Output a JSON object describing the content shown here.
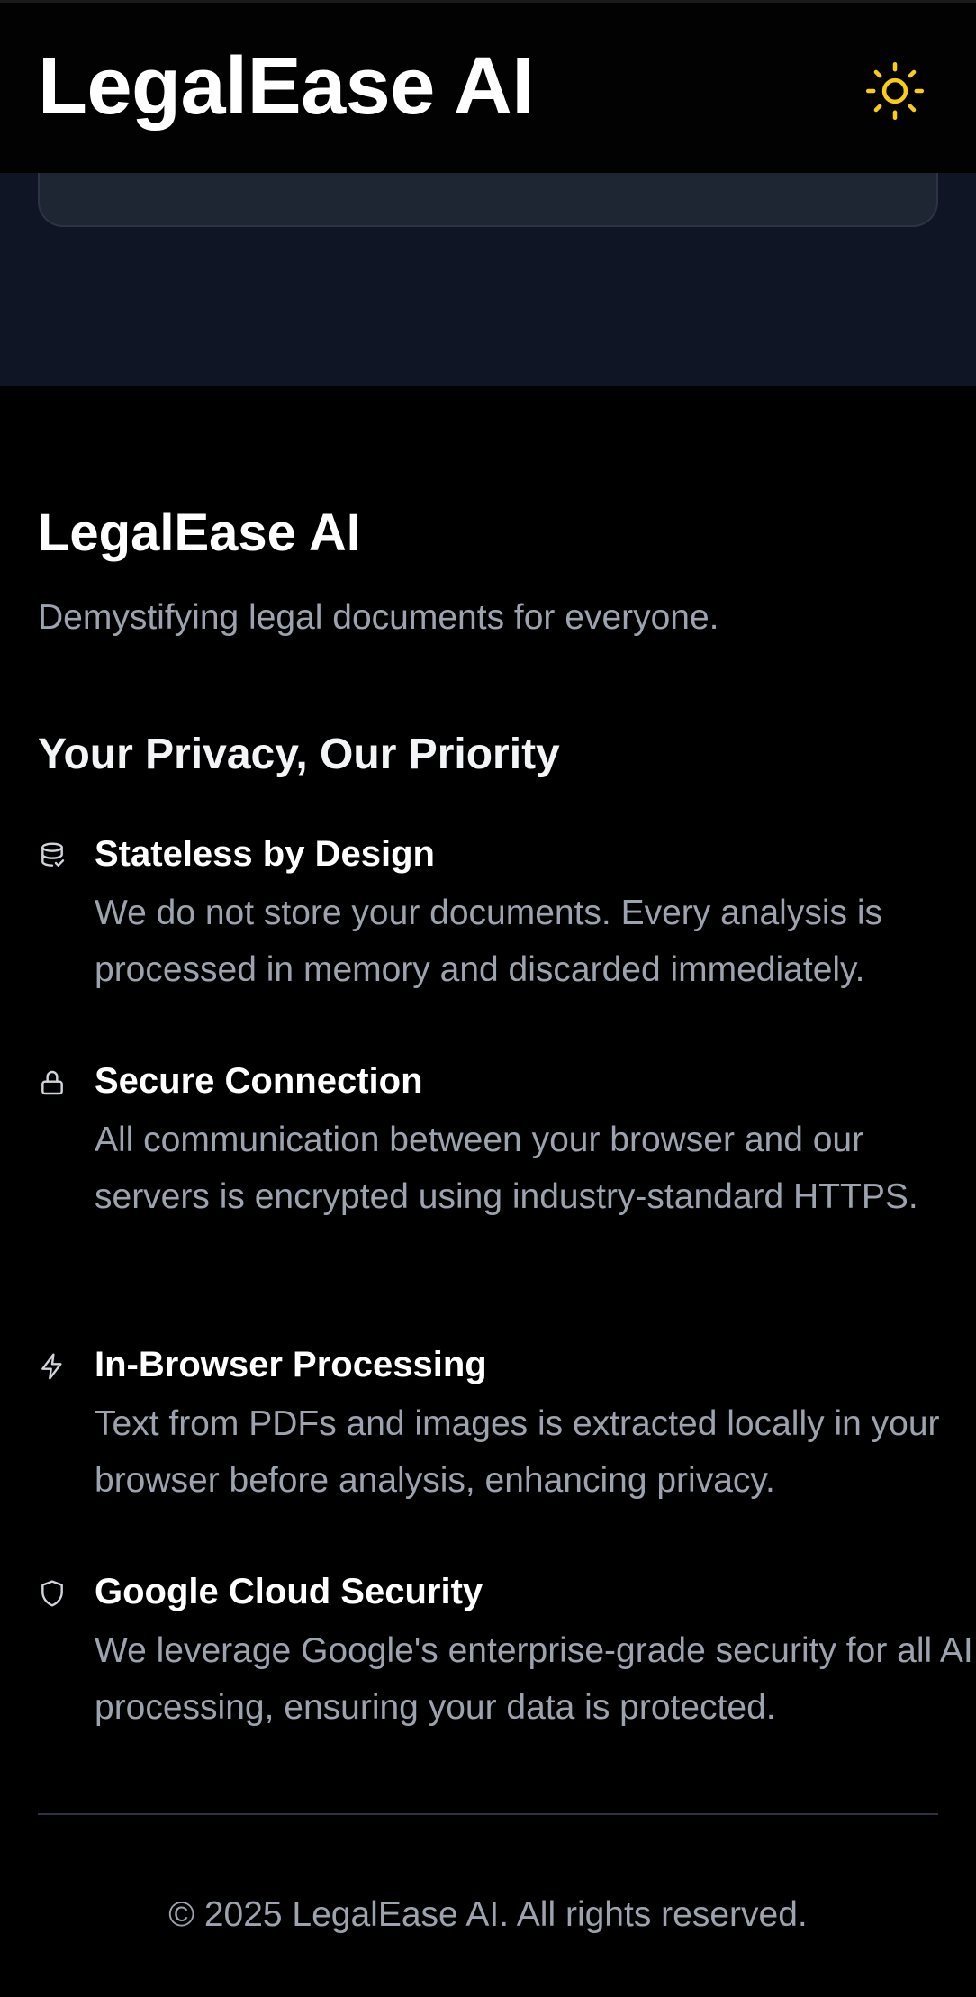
{
  "header": {
    "title": "LegalEase AI",
    "theme_toggle_icon": "sun-icon",
    "accent_color": "#facc15"
  },
  "footer": {
    "brand": "LegalEase AI",
    "tagline": "Demystifying legal documents for everyone.",
    "privacy": {
      "heading": "Your Privacy, Our Priority",
      "items": [
        {
          "icon": "database-icon",
          "title": "Stateless by Design",
          "description": "We do not store your documents. Every analysis is processed in memory and discarded immediately."
        },
        {
          "icon": "lock-icon",
          "title": "Secure Connection",
          "description": "All communication between your browser and our servers is encrypted using industry-standard HTTPS."
        },
        {
          "icon": "lightning-icon",
          "title": "In-Browser Processing",
          "description": "Text from PDFs and images is extracted locally in your browser before analysis, enhancing privacy."
        },
        {
          "icon": "shield-icon",
          "title": "Google Cloud Security",
          "description": "We leverage Google's enterprise-grade security for all AI processing, ensuring your data is protected."
        }
      ]
    },
    "copyright": "© 2025 LegalEase AI. All rights reserved."
  }
}
